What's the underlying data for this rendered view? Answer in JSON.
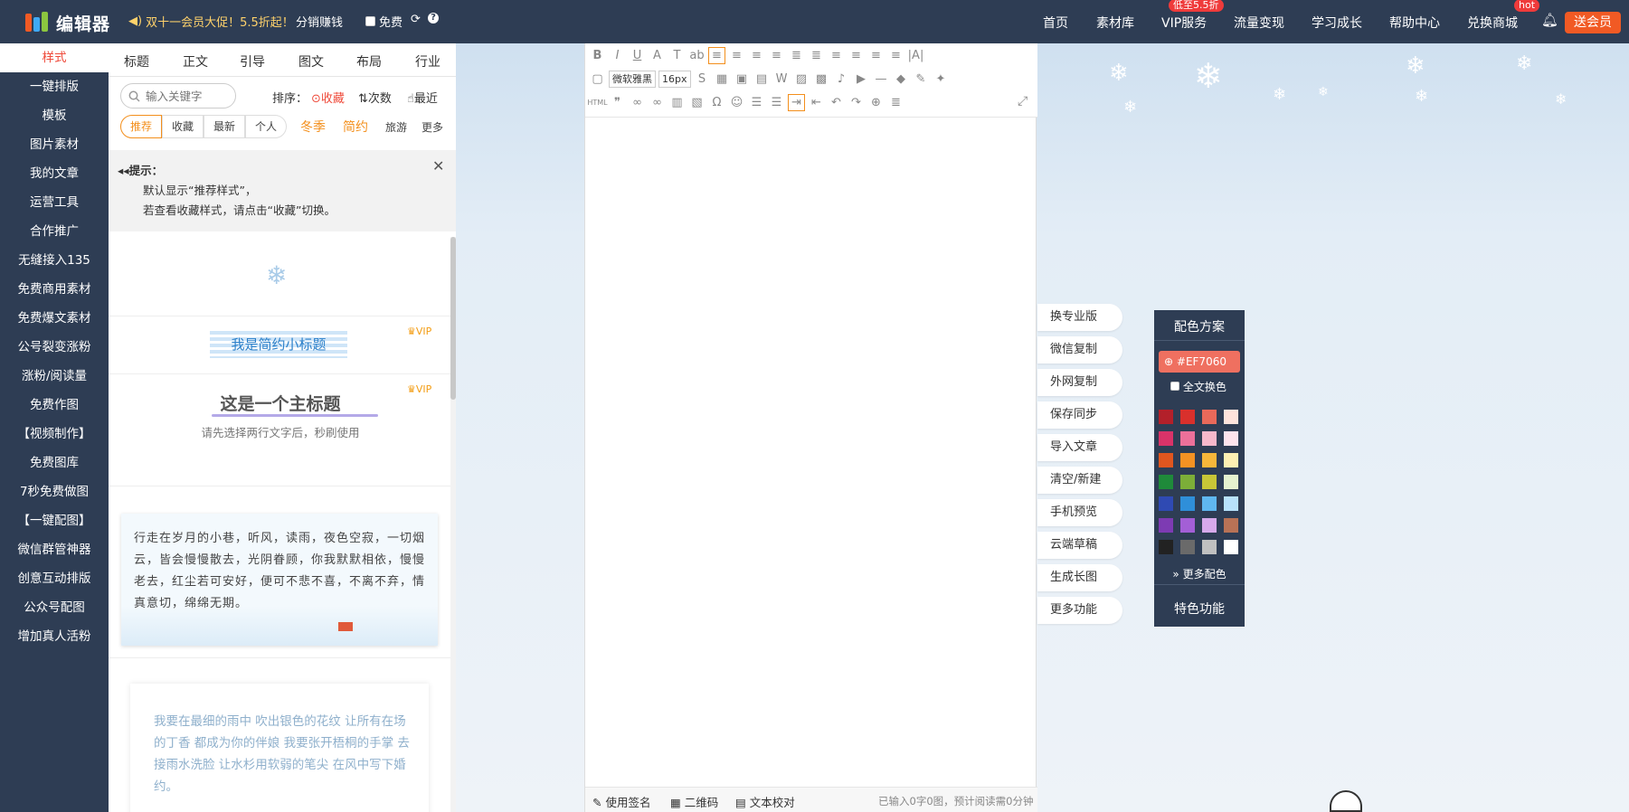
{
  "header": {
    "logo_text": "编辑器",
    "promo": "双十一会员大促！5.5折起！",
    "distribution": "分销赚钱",
    "free": "免费",
    "nav": [
      {
        "label": "首页"
      },
      {
        "label": "素材库"
      },
      {
        "label": "VIP服务",
        "badge": "低至5.5折"
      },
      {
        "label": "流量变现"
      },
      {
        "label": "学习成长"
      },
      {
        "label": "帮助中心"
      },
      {
        "label": "兑换商城",
        "badge": "hot"
      }
    ],
    "send_vip": "送会员"
  },
  "sidebar": {
    "items": [
      {
        "label": "样式"
      },
      {
        "label": "一键排版"
      },
      {
        "label": "模板"
      },
      {
        "label": "图片素材"
      },
      {
        "label": "我的文章"
      },
      {
        "label": "运营工具"
      },
      {
        "label": "合作推广"
      },
      {
        "label": "无缝接入135"
      },
      {
        "label": "免费商用素材"
      },
      {
        "label": "免费爆文素材"
      },
      {
        "label": "公号裂变涨粉"
      },
      {
        "label": "涨粉/阅读量"
      },
      {
        "label": "免费作图"
      },
      {
        "label": "【视频制作】"
      },
      {
        "label": "免费图库"
      },
      {
        "label": "7秒免费做图"
      },
      {
        "label": "【一键配图】"
      },
      {
        "label": "微信群管神器"
      },
      {
        "label": "创意互动排版"
      },
      {
        "label": "公众号配图"
      },
      {
        "label": "增加真人活粉"
      }
    ]
  },
  "style_panel": {
    "categories": [
      "标题",
      "正文",
      "引导",
      "图文",
      "布局",
      "行业"
    ],
    "search_placeholder": "输入关键字",
    "sort_label": "排序：",
    "sort_options": [
      "收藏",
      "次数",
      "最近"
    ],
    "filter_tabs": [
      "推荐",
      "收藏",
      "最新",
      "个人"
    ],
    "hot_tags": [
      "冬季",
      "简约"
    ],
    "tags": [
      "旅游",
      "更多"
    ],
    "tip_title": "提示：",
    "tip_line1": "默认显示“推荐样式”，",
    "tip_line2": "若查看收藏样式，请点击“收藏”切换。",
    "vip_label": "VIP",
    "tpl2_title": "我是简约小标题",
    "tpl3_title": "这是一个主标题",
    "tpl3_sub": "请先选择两行文字后，秒刷使用",
    "tpl4_text": "行走在岁月的小巷，听风，读雨，夜色空寂，一切烟云，皆会慢慢散去，光阴眷顾，你我默默相依，慢慢老去，红尘若可安好，便可不悲不喜，不离不弃，情真意切，绵绵无期。",
    "tpl5_text": "我要在最细的雨中 吹出银色的花纹 让所有在场的丁香 都成为你的伴娘 我要张开梧桐的手掌 去接雨水洗脸 让水杉用软弱的笔尖 在风中写下婚约。"
  },
  "editor": {
    "font_family": "微软雅黑",
    "font_size": "16px",
    "html_label": "HTML",
    "footer": {
      "signature": "使用签名",
      "qrcode": "二维码",
      "proofread": "文本校对",
      "status": "已输入0字0图，预计阅读需0分钟"
    }
  },
  "side_buttons": [
    "换专业版",
    "微信复制",
    "外网复制",
    "保存同步",
    "导入文章",
    "清空/新建",
    "手机预览",
    "云端草稿",
    "生成长图",
    "更多功能"
  ],
  "color_panel": {
    "title": "配色方案",
    "current_color": "#EF7060",
    "all_change": "全文换色",
    "more_colors": "更多配色",
    "special": "特色功能",
    "swatches": [
      [
        "#b3202a",
        "#d9302c",
        "#e9695a",
        "#fde3dc"
      ],
      [
        "#d93369",
        "#ec709a",
        "#f6b8cb",
        "#fde3ec"
      ],
      [
        "#e0561f",
        "#f39223",
        "#f7b73a",
        "#fdf0b3"
      ],
      [
        "#1f8a3a",
        "#7cae38",
        "#c8c637",
        "#e5f2cf"
      ],
      [
        "#2f4ab3",
        "#2f8fd9",
        "#5fb7ef",
        "#b8e2fb"
      ],
      [
        "#7d3bb3",
        "#a35fd6",
        "#d6a9ea",
        "#b87256"
      ],
      [
        "#222222",
        "#6a6a6a",
        "#c0c0c0",
        "#ffffff"
      ]
    ]
  }
}
